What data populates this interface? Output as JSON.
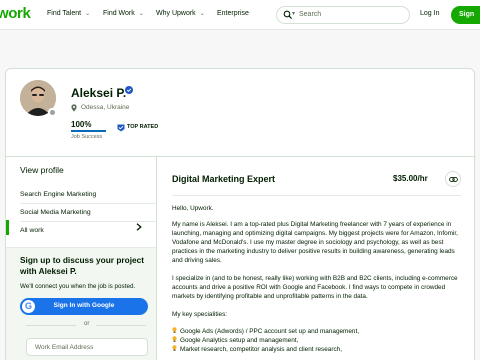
{
  "header": {
    "logo": "work",
    "nav": [
      "Find Talent",
      "Find Work",
      "Why Upwork",
      "Enterprise"
    ],
    "search_placeholder": "Search",
    "login": "Log In",
    "signup": "Sign"
  },
  "profile": {
    "name": "Aleksei P.",
    "location": "Odessa, Ukraine",
    "job_success_value": "100%",
    "job_success_fraction": 1.0,
    "job_success_label": "Job Success",
    "top_rated_label": "TOP RATED"
  },
  "sidebar": {
    "title": "View profile",
    "items": [
      "Search Engine Marketing",
      "Social Media Marketing",
      "All work"
    ],
    "active_index": 2
  },
  "signup_box": {
    "title": "Sign up to discuss your project with Aleksei P.",
    "subtitle": "We'll connect you when the job is posted.",
    "google_button": "Sign In with Google",
    "or": "or",
    "email_placeholder": "Work Email Address"
  },
  "main": {
    "title": "Digital Marketing Expert",
    "rate": "$35.00/hr",
    "greeting": "Hello, Upwork.",
    "paragraph1": "My name is Aleksei. I am a top-rated plus Digital Marketing freelancer with 7 years of experience in launching, managing and optimizing digital campaigns. My biggest projects were for Amazon, Infomir, Vodafone and McDonald's. I use my master degree in sociology and psychology, as well as best practices in the marketing industry to deliver positive results in building awareness, generating leads and driving sales.",
    "paragraph2": "I specialize in (and to be honest, really like) working with B2B and B2C clients, including e-commerce accounts and drive a positive ROI with Google and Facebook. I find ways to compete in crowded markets by identifying profitable and unprofitable patterns in the data.",
    "specialities_heading": "My key specialities:",
    "specialities": [
      "Google Ads (Adwords) / PPC account set up and management,",
      "Google Analytics setup and management,",
      "Market research, competitor analysis and client research,"
    ]
  }
}
